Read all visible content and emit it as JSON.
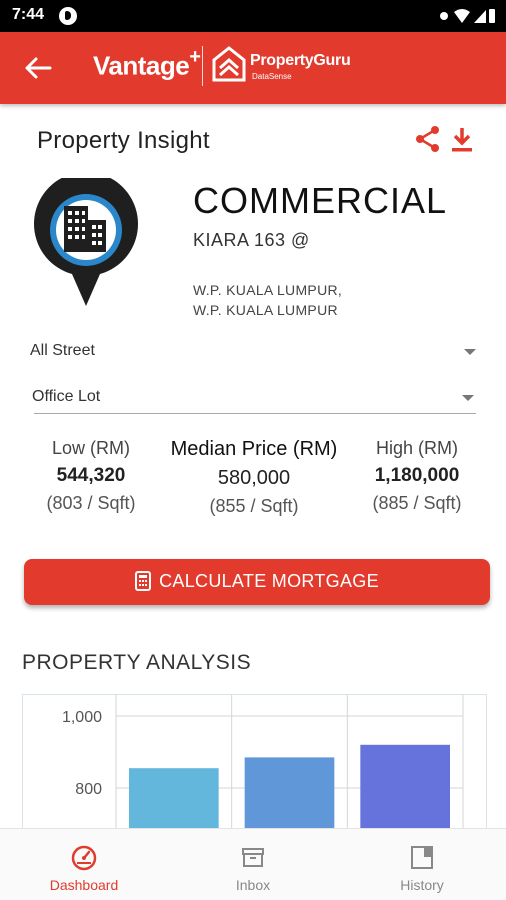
{
  "status_bar": {
    "time": "7:44"
  },
  "app_bar": {
    "brand_left": "Vantage",
    "brand_left_sup": "+",
    "brand_right": "PropertyGuru",
    "brand_right_sub": "DataSense"
  },
  "page": {
    "title": "Property Insight"
  },
  "property": {
    "type": "COMMERCIAL",
    "name": "KIARA 163 @",
    "address_line1": "W.P. KUALA LUMPUR,",
    "address_line2": "W.P. KUALA LUMPUR"
  },
  "filters": {
    "street": {
      "value": "All Street"
    },
    "unit_type": {
      "value": "Office Lot"
    }
  },
  "prices": {
    "low": {
      "label": "Low (RM)",
      "value": "544,320",
      "psf": "(803 / Sqft)"
    },
    "median": {
      "label": "Median Price (RM)",
      "value": "580,000",
      "psf": "(855 / Sqft)"
    },
    "high": {
      "label": "High (RM)",
      "value": "1,180,000",
      "psf": "(885 / Sqft)"
    }
  },
  "mortgage_button": {
    "label": "CALCULATE MORTGAGE"
  },
  "analysis": {
    "title": "PROPERTY ANALYSIS"
  },
  "chart_data": {
    "type": "bar",
    "categories": [
      "",
      "",
      ""
    ],
    "values": [
      855,
      885,
      920
    ],
    "colors": [
      "#63b6dc",
      "#5f97d9",
      "#6673dc"
    ],
    "tick_labels": [
      "1,000",
      "800"
    ],
    "ticks": [
      1000,
      800
    ],
    "ylim": [
      700,
      1000
    ],
    "grid": true
  },
  "bottom_nav": {
    "items": [
      {
        "label": "Dashboard",
        "icon": "dashboard-icon",
        "active": true
      },
      {
        "label": "Inbox",
        "icon": "inbox-icon",
        "active": false
      },
      {
        "label": "History",
        "icon": "history-icon",
        "active": false
      }
    ]
  },
  "theme": {
    "accent": "#e23b2e"
  }
}
